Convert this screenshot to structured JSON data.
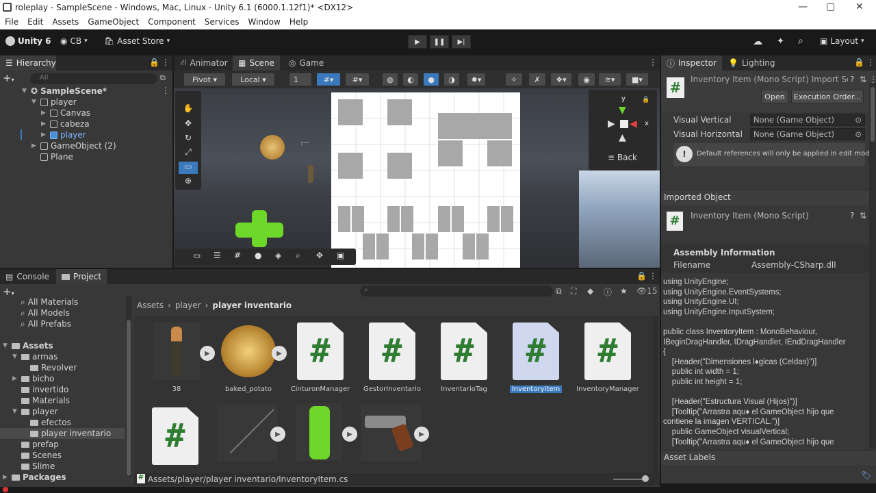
{
  "window": {
    "title": "roleplay - SampleScene - Windows, Mac, Linux - Unity 6.1 (6000.1.12f1)* <DX12>"
  },
  "menu": [
    "File",
    "Edit",
    "Assets",
    "GameObject",
    "Component",
    "Services",
    "Window",
    "Help"
  ],
  "toolbar": {
    "product": "Unity 6",
    "account": "CB",
    "asset_store": "Asset Store",
    "layout": "Layout"
  },
  "tabs": {
    "hierarchy": "Hierarchy",
    "animator": "Animator",
    "scene": "Scene",
    "game": "Game",
    "inspector": "Inspector",
    "lighting": "Lighting",
    "console": "Console",
    "project": "Project"
  },
  "hierarchy": {
    "search_placeholder": "All",
    "rows": [
      "SampleScene*",
      "player",
      "Canvas",
      "cabeza",
      "player",
      "GameObject (2)",
      "Plane"
    ]
  },
  "scene": {
    "pivot": "Pivot",
    "local": "Local",
    "grid_value": "1",
    "gizmo_back": "Back",
    "axis_y": "y",
    "axis_x": "x"
  },
  "inspector": {
    "title": "Inventory Item (Mono Script) Import Se",
    "open": "Open",
    "execution_order": "Execution Order...",
    "fields": [
      {
        "label": "Visual Vertical",
        "value": "None (Game Object)"
      },
      {
        "label": "Visual Horizontal",
        "value": "None (Game Object)"
      }
    ],
    "help_text": "Default references will only be applied in edit mode.",
    "imported_object": "Imported Object",
    "imported_name": "Inventory Item (Mono Script)",
    "assembly_info": "Assembly Information",
    "filename_label": "Filename",
    "filename_value": "Assembly-CSharp.dll",
    "code": "using UnityEngine;\nusing UnityEngine.EventSystems;\nusing UnityEngine.UI;\nusing UnityEngine.InputSystem;\n\npublic class InventoryItem : MonoBehaviour,\nIBeginDragHandler, IDragHandler, IEndDragHandler\n{\n    [Header(\"Dimensiones l♦gicas (Celdas)\")]\n    public int width = 1;\n    public int height = 1;\n\n    [Header(\"Estructura Visual (Hijos)\")]\n    [Tooltip(\"Arrastra aqu♦ el GameObject hijo que\ncontiene la imagen VERTICAL.\")]\n    public GameObject visualVertical;\n    [Tooltip(\"Arrastra aqu♦ el GameObject hijo que",
    "asset_labels": "Asset Labels"
  },
  "project": {
    "search_placeholder": "",
    "count": "15",
    "favorites": [
      "All Materials",
      "All Models",
      "All Prefabs"
    ],
    "tree": [
      {
        "label": "Assets",
        "level": 0
      },
      {
        "label": "armas",
        "level": 1
      },
      {
        "label": "Revolver",
        "level": 2
      },
      {
        "label": "bicho",
        "level": 1
      },
      {
        "label": "invertido",
        "level": 1
      },
      {
        "label": "Materials",
        "level": 1
      },
      {
        "label": "player",
        "level": 1
      },
      {
        "label": "efectos",
        "level": 2
      },
      {
        "label": "player inventario",
        "level": 2
      },
      {
        "label": "prefap",
        "level": 1
      },
      {
        "label": "Scenes",
        "level": 1
      },
      {
        "label": "Slime",
        "level": 1
      },
      {
        "label": "Packages",
        "level": 0
      }
    ],
    "breadcrumb": [
      "Assets",
      "player",
      "player inventario"
    ],
    "assets_row1": [
      "38",
      "baked_potato",
      "CinturonManager",
      "GestorInventario",
      "InventarioTag",
      "InventoryItem",
      "InventoryManager"
    ],
    "selected_path": "Assets/player/player inventario/InventoryItem.cs"
  },
  "colors": {
    "accent": "#3a79bb",
    "script_green": "#2e7d32",
    "panel": "#383838"
  }
}
